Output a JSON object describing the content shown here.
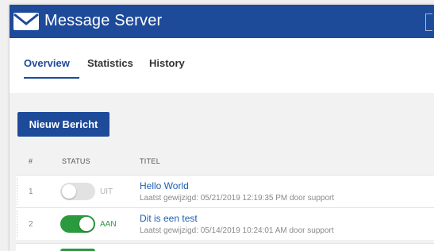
{
  "app": {
    "title": "Message Server",
    "brand_color": "#1e4a9a",
    "icon": "envelope-icon"
  },
  "tabs": [
    {
      "label": "Overview",
      "active": true
    },
    {
      "label": "Statistics",
      "active": false
    },
    {
      "label": "History",
      "active": false
    }
  ],
  "toolbar": {
    "new_message_label": "Nieuw Bericht"
  },
  "table": {
    "columns": [
      "#",
      "STATUS",
      "TITEL"
    ],
    "rows": [
      {
        "number": "1",
        "enabled": false,
        "status_label": "UIT",
        "title": "Hello World",
        "meta": "Laatst gewijzigd: 05/21/2019 12:19:35 PM door support"
      },
      {
        "number": "2",
        "enabled": true,
        "status_label": "AAN",
        "title": "Dit is een test",
        "meta": "Laatst gewijzigd: 05/14/2019 10:24:01 AM door support"
      },
      {
        "enabled": true
      }
    ]
  },
  "colors": {
    "on": "#2b9a3f",
    "off": "#e2e2e2",
    "link": "#1e5fb3"
  }
}
